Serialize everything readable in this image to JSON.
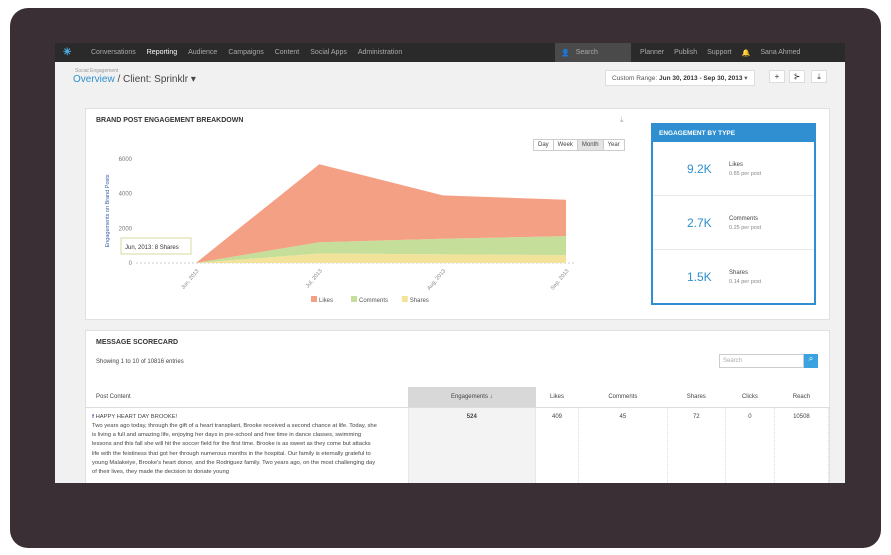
{
  "nav": {
    "items": [
      "Conversations",
      "Reporting",
      "Audience",
      "Campaigns",
      "Content",
      "Social Apps",
      "Administration"
    ],
    "active": "Reporting",
    "search_placeholder": "Search",
    "right": [
      "Planner",
      "Publish",
      "Support"
    ],
    "user": "Sana Ahmed"
  },
  "header": {
    "section": "Social Engagement",
    "overview": "Overview",
    "client": "/ Client: Sprinklr",
    "range_label": "Custom Range:",
    "range_value": "Jun 30, 2013 - Sep 30, 2013"
  },
  "chart_panel": {
    "title": "BRAND POST ENGAGEMENT BREAKDOWN",
    "timeframes": [
      "Day",
      "Week",
      "Month",
      "Year"
    ],
    "selected": "Month",
    "tooltip": "Jun, 2013: 8 Shares"
  },
  "chart_data": {
    "type": "area",
    "stacked": true,
    "categories": [
      "Jun, 2013",
      "Jul, 2013",
      "Aug, 2013",
      "Sep, 2013"
    ],
    "ylabel": "Engagements on Brand Posts",
    "ylim": [
      0,
      6000
    ],
    "yticks": [
      0,
      2000,
      4000,
      6000
    ],
    "legend": "bottom",
    "series": [
      {
        "name": "Likes",
        "color": "#f4a084",
        "values": [
          0,
          4500,
          2500,
          2100
        ]
      },
      {
        "name": "Comments",
        "color": "#c5df9a",
        "values": [
          0,
          650,
          900,
          1100
        ]
      },
      {
        "name": "Shares",
        "color": "#f3e39a",
        "values": [
          8,
          550,
          500,
          450
        ]
      }
    ]
  },
  "engagement_by_type": {
    "title": "ENGAGEMENT BY TYPE",
    "rows": [
      {
        "value": "9.2K",
        "label": "Likes",
        "sub": "0.85 per post"
      },
      {
        "value": "2.7K",
        "label": "Comments",
        "sub": "0.25 per post"
      },
      {
        "value": "1.5K",
        "label": "Shares",
        "sub": "0.14 per post"
      }
    ]
  },
  "scorecard": {
    "title": "MESSAGE SCORECARD",
    "showing": "Showing 1 to 10 of 10816 entries",
    "search_placeholder": "Search",
    "columns": [
      "Post Content",
      "Engagements",
      "Likes",
      "Comments",
      "Shares",
      "Clicks",
      "Reach"
    ],
    "rows": [
      {
        "title": "HAPPY HEART DAY BROOKE!",
        "text": "Two years ago today, through the gift of a heart transplant, Brooke received a second chance at life. Today, she is living a full and amazing life, enjoying her days in pre-school and free time in dance classes, swimming lessons and this fall she will hit the soccer field for the first time. Brooke is as sweet as they come but attacks life with the feistiness that got her through numerous months in the hospital. Our family is eternally grateful to young Malakeiye, Brooke's heart donor, and the Rodriguez family. Two years ago, on the most challenging day of their lives, they made the decision to donate young",
        "values": [
          "524",
          "409",
          "45",
          "72",
          "0",
          "10508"
        ]
      }
    ]
  }
}
